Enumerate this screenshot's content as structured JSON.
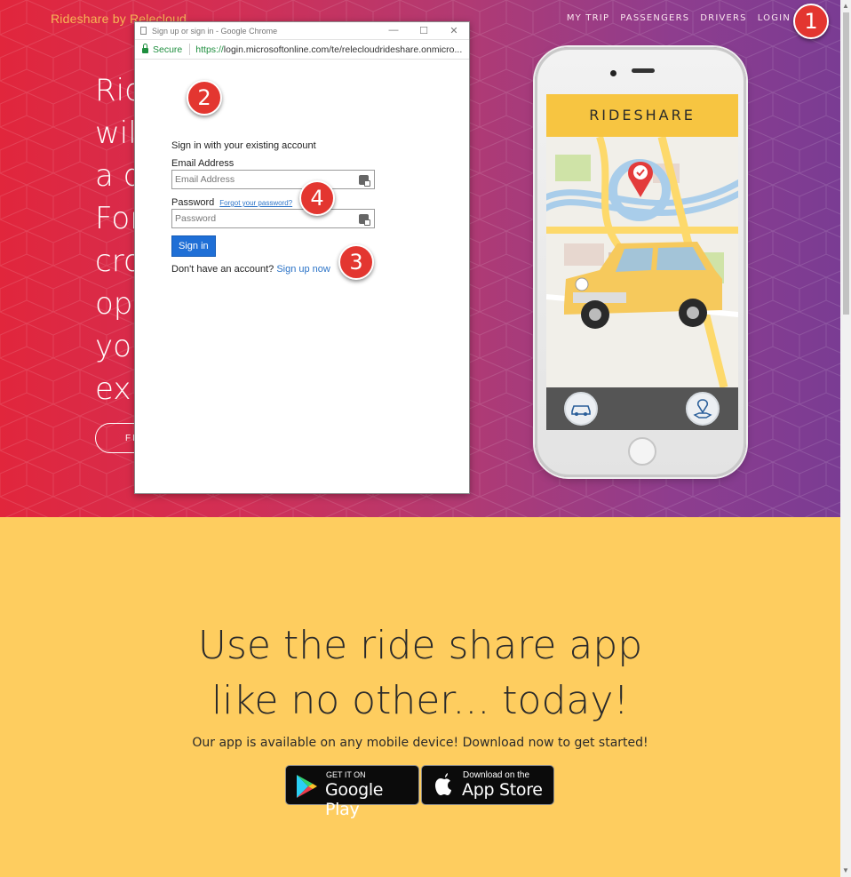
{
  "site": {
    "brand": "Rideshare by Relecloud",
    "nav": [
      "MY TRIP",
      "PASSENGERS",
      "DRIVERS",
      "LOGIN"
    ]
  },
  "hero": {
    "lines": [
      "Rid",
      "wil",
      "a d",
      "For",
      "cro",
      "opt",
      "you",
      "exp"
    ],
    "button_label": "FI"
  },
  "popup": {
    "window_title": "Sign up or sign in - Google Chrome",
    "secure_label": "Secure",
    "url_scheme": "https://",
    "url_rest": "login.microsoftonline.com/te/relecloudrideshare.onmicro...",
    "window_controls": [
      "—",
      "☐",
      "✕"
    ],
    "form": {
      "heading": "Sign in with your existing account",
      "email_label": "Email Address",
      "email_placeholder": "Email Address",
      "email_value": "",
      "password_label": "Password",
      "forgot_link": "Forgot your password?",
      "password_placeholder": "Password",
      "password_value": "",
      "signin_button": "Sign in",
      "no_account_text": "Don't have an account?",
      "signup_link": "Sign up now"
    }
  },
  "phone": {
    "app_title": "RIDESHARE",
    "icons": [
      "map-pin-check-icon",
      "car-icon",
      "map-location-icon"
    ]
  },
  "promo": {
    "title_line1": "Use the ride share app",
    "title_line2": "like no other... today!",
    "subtitle": "Our app is available on any mobile device! Download now to get started!",
    "google_play": {
      "small": "GET IT ON",
      "big": "Google Play"
    },
    "app_store": {
      "small": "Download on the",
      "big": "App Store"
    }
  },
  "callouts": [
    "1",
    "2",
    "3",
    "4"
  ],
  "colors": {
    "hero_start": "#e1263c",
    "hero_end": "#7a3c93",
    "brand_text": "#f6b655",
    "promo_bg": "#fecd5f",
    "signin_button": "#1f6fd6",
    "link": "#2b73c7",
    "secure_green": "#1e8e3e",
    "callout": "#e33630"
  }
}
